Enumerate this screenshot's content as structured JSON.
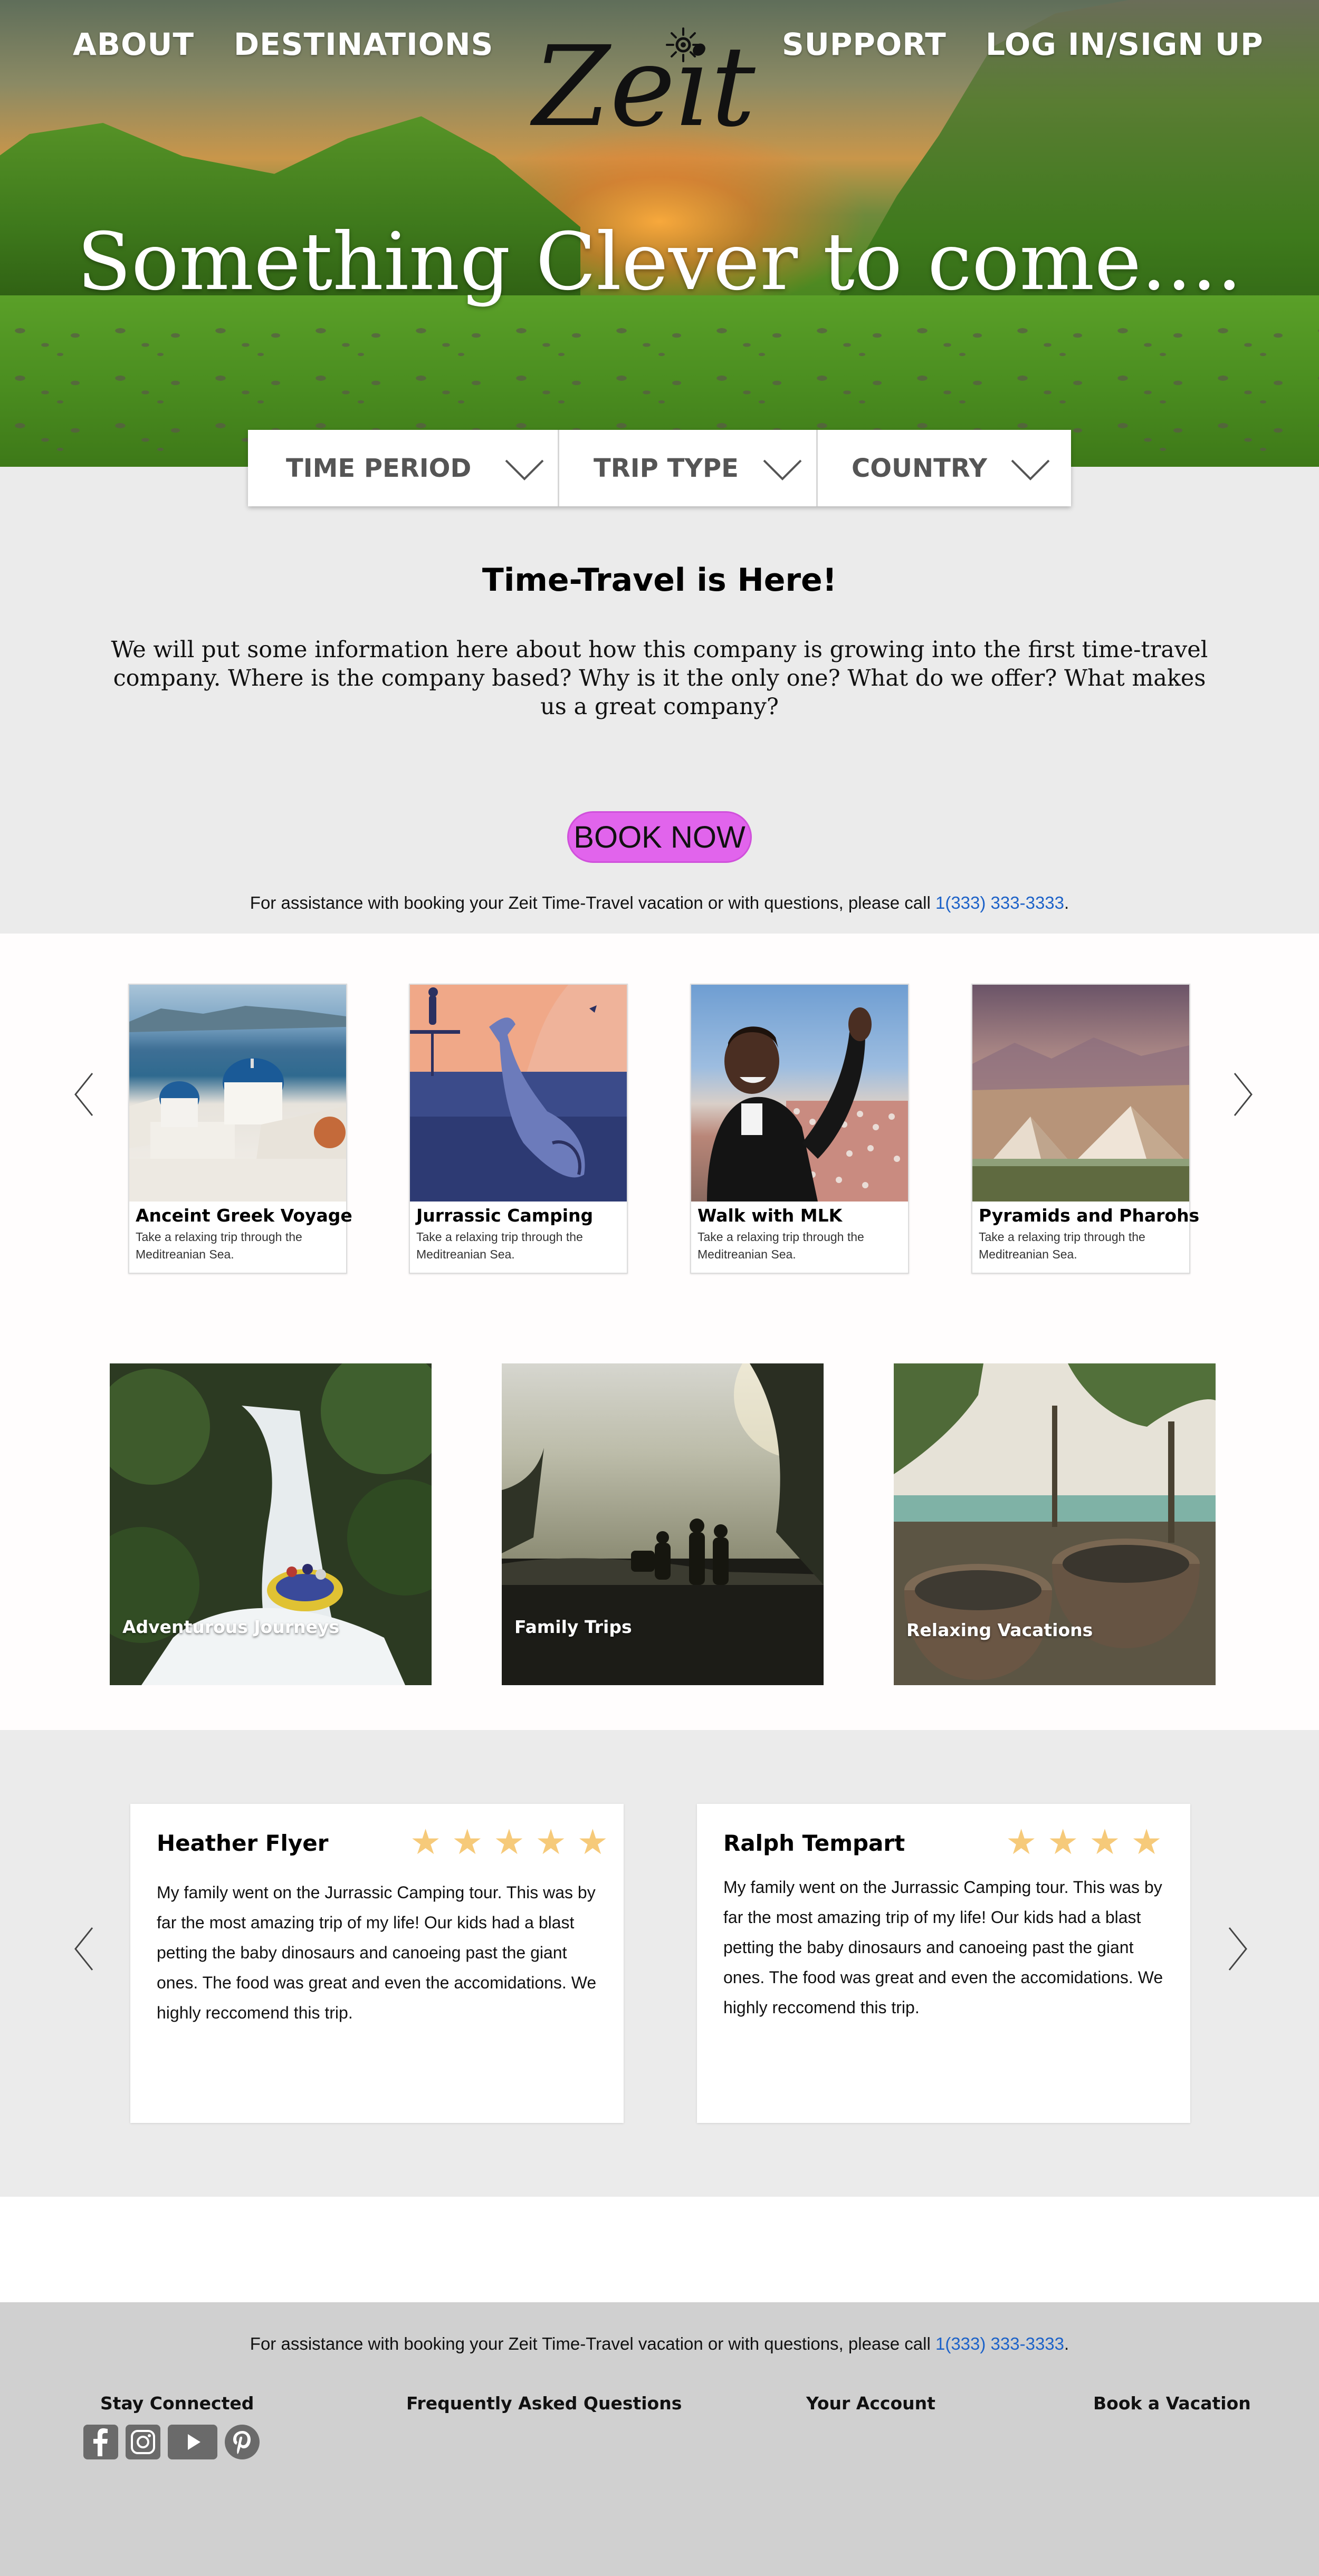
{
  "nav": {
    "about": "ABOUT",
    "destinations": "DESTINATIONS",
    "support": "SUPPORT",
    "login": "LOG IN/SIGN UP"
  },
  "logo": {
    "text": "Zeit",
    "icon": "sun-icon"
  },
  "hero": {
    "title": "Something Clever to come...."
  },
  "filters": [
    {
      "label": "TIME PERIOD",
      "icon": "chevron-down-icon"
    },
    {
      "label": "TRIP TYPE",
      "icon": "chevron-down-icon"
    },
    {
      "label": "COUNTRY",
      "icon": "chevron-down-icon"
    }
  ],
  "intro": {
    "heading": "Time-Travel is Here!",
    "body": "We will put some information here about how this company is growing into the first time-travel company. Where is the company based? Why is it the only one? What do we offer? What makes us a great company?",
    "book_button": "BOOK NOW",
    "assist_text": "For assistance with booking your Zeit Time-Travel vacation or with questions, please call ",
    "assist_phone": "1(333) 333-3333",
    "assist_end": "."
  },
  "destinations": [
    {
      "title": "Anceint Greek Voyage",
      "description": "Take a relaxing trip through the Meditreanian Sea."
    },
    {
      "title": "Jurrassic Camping",
      "description": "Take a relaxing trip through the Meditreanian Sea."
    },
    {
      "title": "Walk with MLK",
      "description": "Take a relaxing trip through the Meditreanian Sea."
    },
    {
      "title": "Pyramids and Pharohs",
      "description": "Take a relaxing trip through the Meditreanian Sea."
    }
  ],
  "categories": [
    {
      "label": "Adventurous Journeys"
    },
    {
      "label": "Family Trips"
    },
    {
      "label": "Relaxing Vacations"
    }
  ],
  "reviews": [
    {
      "name": "Heather Flyer",
      "rating": 5,
      "stars": "★★★★★",
      "text": "My family went on the Jurrassic Camping tour. This was by far the most amazing trip of my life! Our kids had a blast petting the baby dinosaurs and canoeing past the giant ones. The food was great and even the accomidations. We highly reccomend this trip."
    },
    {
      "name": "Ralph Tempart",
      "rating": 4,
      "stars": "★★★★",
      "text": "My family went on the Jurrassic Camping tour. This was by far the most amazing trip of my life! Our kids had a blast petting the baby dinosaurs and canoeing past the giant ones. The food was great and even the accomidations. We highly reccomend this trip."
    }
  ],
  "footer": {
    "assist_text": "For assistance with booking your Zeit Time-Travel vacation or with questions, please call ",
    "assist_phone": "1(333) 333-3333",
    "assist_end": ".",
    "stay_connected": "Stay Connected",
    "faq": "Frequently Asked Questions",
    "account": "Your Account",
    "book": "Book a Vacation",
    "social": [
      "facebook-icon",
      "instagram-icon",
      "youtube-icon",
      "pinterest-icon"
    ]
  },
  "colors": {
    "accent_button": "#e164ec",
    "link": "#1d62c8",
    "star": "#f6ca7a",
    "section_gray": "#ebebeb",
    "footer_gray": "#d0d0d0"
  }
}
